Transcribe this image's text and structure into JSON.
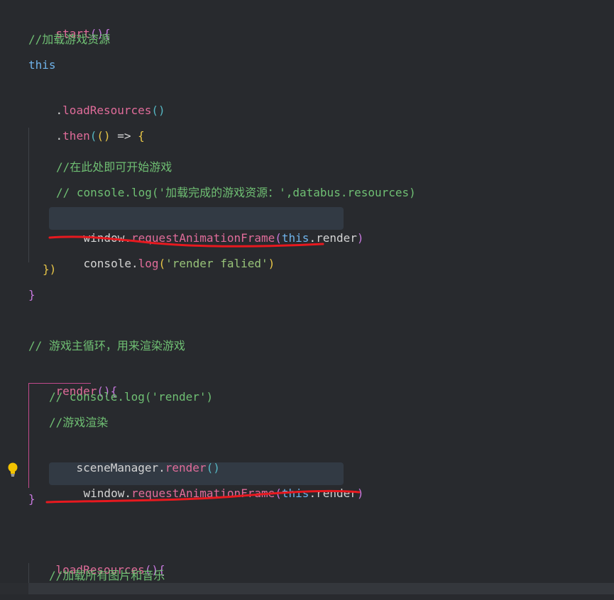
{
  "editor": {
    "theme": {
      "background": "#282a2e",
      "function": "#e06c9a",
      "comment": "#6fbf73",
      "keyword": "#6fb3ea",
      "annotation": "#e8191f",
      "highlight": "#323a44"
    },
    "lines": {
      "l1": {
        "name": "start",
        "p": "(){"
      },
      "l2": {
        "comment": "//加载游戏资源"
      },
      "l3": {
        "kw": "this"
      },
      "l4": {
        "dot": ".",
        "name": "loadResources",
        "p": "()"
      },
      "l5": {
        "dot": ".",
        "name": "then",
        "p1": "(",
        "p2": "()",
        "arrow": " => ",
        "p3": "{"
      },
      "l6": {
        "comment": "//在此处即可开始游戏"
      },
      "l7": {
        "comment": "// console.log('加载完成的游戏资源：',databus.resources)"
      },
      "l8": {
        "obj": "window.",
        "fn": "requestAnimationFrame",
        "p1": "(",
        "kw": "this",
        "rest": ".render",
        "p2": ")"
      },
      "l9": {
        "obj": "console.",
        "fn": "log",
        "p1": "(",
        "str": "'render falied'",
        "p2": ")"
      },
      "l10": {
        "text": "})"
      },
      "l11": {
        "text": "}"
      },
      "l12": {
        "comment": "// 游戏主循环，用来渲染游戏"
      },
      "l13": {
        "name": "render",
        "p": "(){"
      },
      "l14": {
        "comment": "// console.log('render')"
      },
      "l15": {
        "comment": "//游戏渲染"
      },
      "l16": {
        "obj": "sceneManager.",
        "fn": "render",
        "p": "()"
      },
      "l17": {
        "obj": "window.",
        "fn": "requestAnimationFrame",
        "p1": "(",
        "kw": "this",
        "rest": ".render",
        "p2": ")"
      },
      "l18": {
        "text": "}"
      },
      "l19": {
        "name": "loadResources",
        "p": "(){"
      },
      "l20": {
        "comment": "//加载所有图片和音乐"
      }
    },
    "lightbulb_icon": "lightbulb-icon"
  }
}
